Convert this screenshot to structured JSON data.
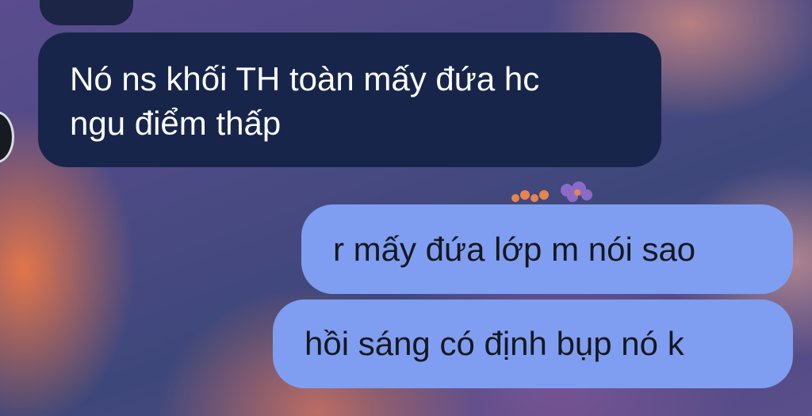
{
  "messages": [
    {
      "direction": "received",
      "lines": [
        "Nó ns khối TH toàn mấy đứa hc",
        "ngu điểm thấp"
      ]
    },
    {
      "direction": "sent",
      "text": "r mấy đứa lớp m nói sao"
    },
    {
      "direction": "sent",
      "text": "hồi sáng có định bụp nó k"
    }
  ],
  "colors": {
    "received_bubble": "#17254a",
    "sent_bubble": "#7f9ef2",
    "received_text": "#ffffff",
    "sent_text": "#16181f"
  },
  "icons": {
    "avatar": "avatar",
    "reaction": "flower-sticker-icon"
  }
}
